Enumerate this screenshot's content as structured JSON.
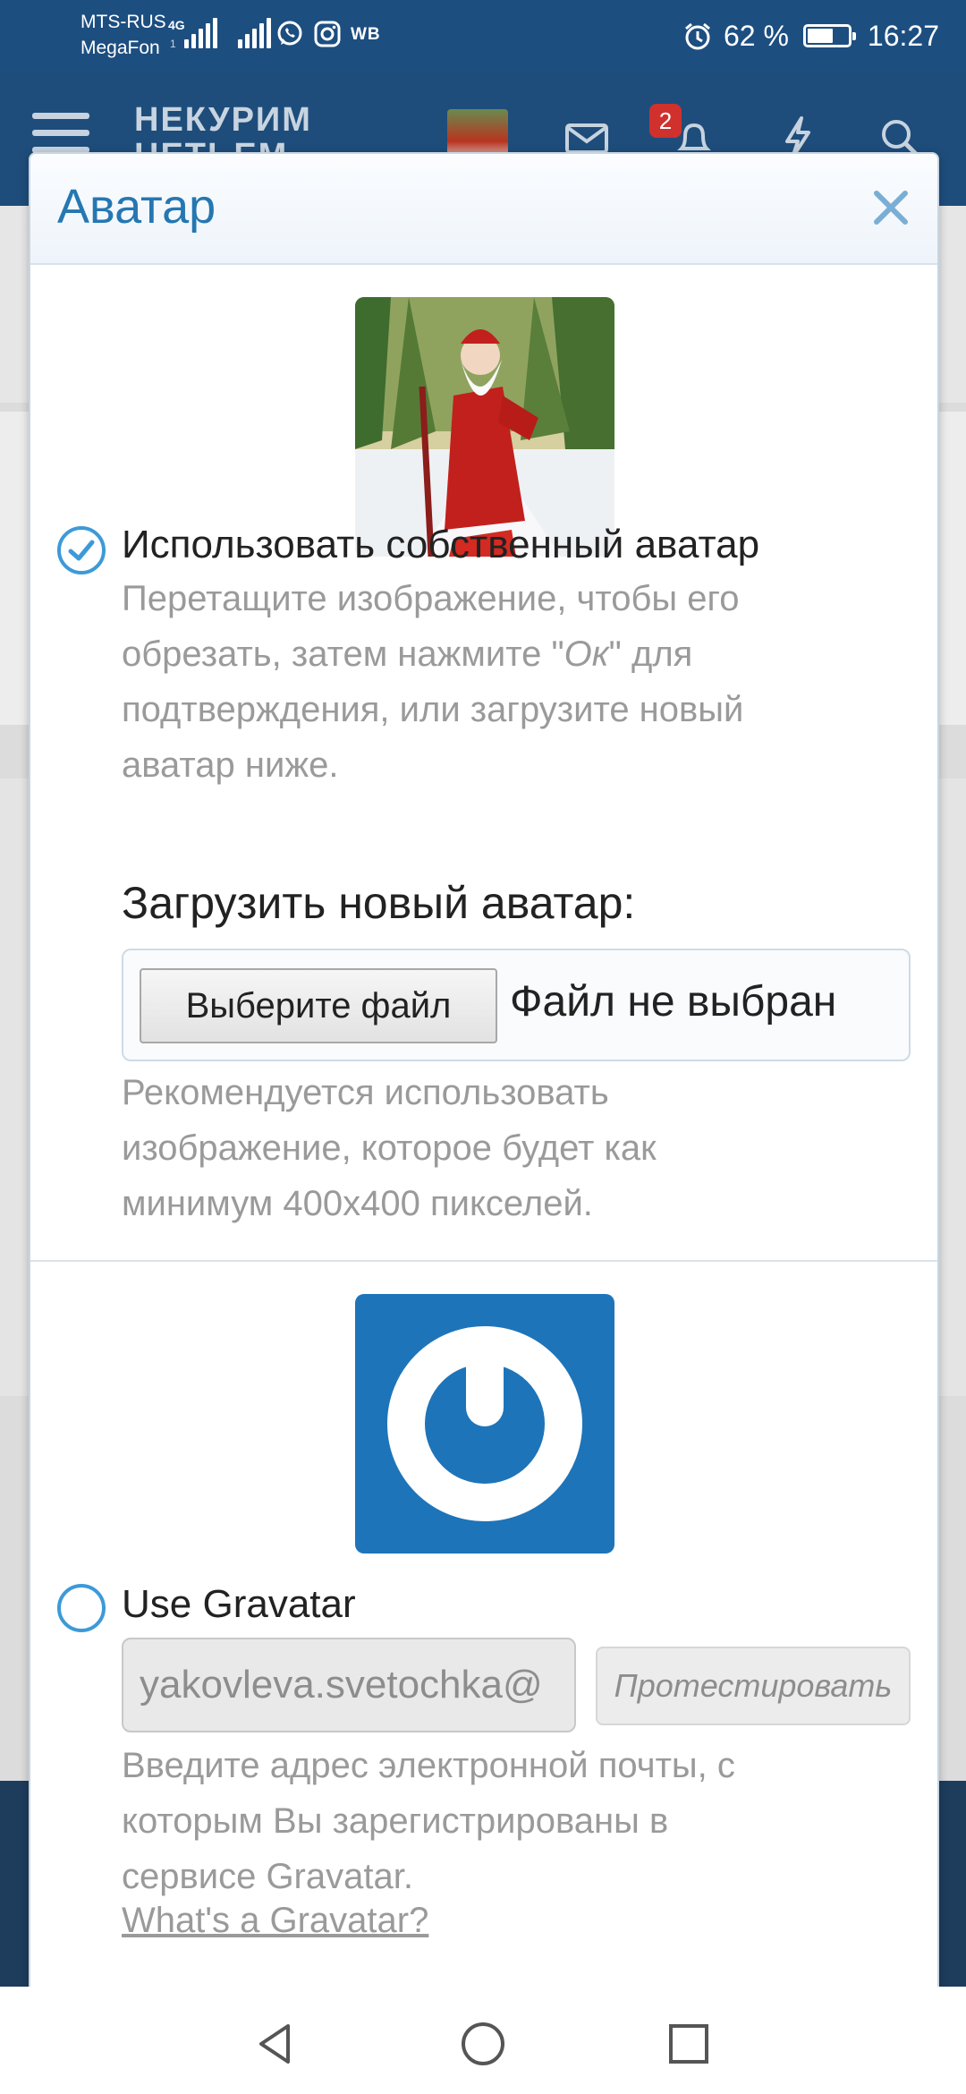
{
  "status_bar": {
    "carrier1": "MTS-RUS",
    "carrier2": "MegaFon",
    "net_type": "4G",
    "net_type2": "1",
    "wb": "WB",
    "battery": "62 %",
    "time": "16:27"
  },
  "header": {
    "logo_line1": "НЕКУРИМ",
    "logo_line2": "НЕТЬЕМ",
    "notifications_count": "2"
  },
  "modal": {
    "title": "Аватар",
    "custom": {
      "label": "Использовать собственный аватар",
      "hint_1": "Перетащите изображение, чтобы его",
      "hint_2a": "обрезать, затем нажмите \"",
      "hint_ok": "Ок",
      "hint_2b": "\" для",
      "hint_3": "подтверждения, или загрузите новый",
      "hint_4": "аватар ниже.",
      "selected": true
    },
    "upload": {
      "label": "Загрузить новый аватар:",
      "button": "Выберите файл",
      "status": "Файл не выбран",
      "hint_1": "Рекомендуется использовать",
      "hint_2": "изображение, которое будет как",
      "hint_3": "минимум 400x400 пикселей."
    },
    "gravatar": {
      "label": "Use Gravatar",
      "email_value": "yakovleva.svetochka@",
      "test_button": "Протестировать",
      "hint_1": "Введите адрес электронной почты, с",
      "hint_2": "которым Вы зарегистрированы в",
      "hint_3": "сервисе Gravatar.",
      "link": "What's a Gravatar?",
      "selected": false
    }
  },
  "colors": {
    "status_bar": "#1d4e80",
    "app_header": "#1e4d7b",
    "accent": "#2577b1",
    "radio": "#3d9ad8",
    "gravatar_bg": "#1e74b9"
  },
  "icons": [
    "signal-icon",
    "wifi-icon",
    "whatsapp-icon",
    "instagram-icon",
    "alarm-icon",
    "battery-icon",
    "menu-icon",
    "mail-icon",
    "bell-icon",
    "lightning-icon",
    "search-icon",
    "close-icon",
    "check-icon",
    "back-icon",
    "home-icon",
    "recents-icon"
  ]
}
